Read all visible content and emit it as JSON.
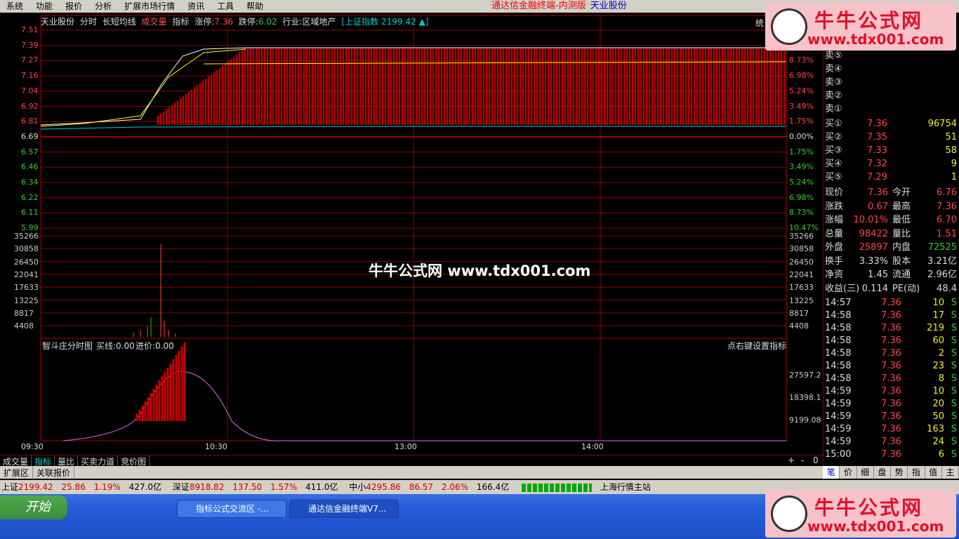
{
  "menu": [
    "系统",
    "功能",
    "报价",
    "分析",
    "扩展市场行情",
    "资讯",
    "工具",
    "帮助"
  ],
  "app_title": "通达信金融终端-内测版",
  "stock_name": "天业股份",
  "header": {
    "stock": "天业股份",
    "items": [
      "分时",
      "长短均线",
      "成交量",
      "指标"
    ],
    "limit_up_label": "涨停:",
    "limit_up": "7.36",
    "limit_down_label": "跌停:",
    "limit_down": "6.02",
    "industry": "行业:区域地产",
    "index_label": "[上证指数",
    "index_value": "2199.42",
    "index_arrow": "▲]",
    "top_right": "统"
  },
  "price_axis": [
    "7.51",
    "7.39",
    "7.27",
    "7.16",
    "7.04",
    "6.92",
    "6.81",
    "6.69",
    "6.57",
    "6.46",
    "6.34",
    "6.22",
    "6.11",
    "5.99"
  ],
  "pct_axis": [
    "8.73%",
    "6.98%",
    "5.24%",
    "3.49%",
    "1.75%",
    "0.00%",
    "1.75%",
    "3.49%",
    "5.24%",
    "6.98%",
    "8.73%",
    "10.47%"
  ],
  "volume_axis": [
    "35266",
    "30858",
    "26450",
    "22041",
    "17633",
    "13225",
    "8817",
    "4408"
  ],
  "indicator": {
    "title": "智斗庄分时图",
    "buy": "买线:0.00",
    "enter": "进价:0.00",
    "right_hint": "点右键设置指标",
    "axis": [
      "27597.2",
      "18398.1",
      "9199.08"
    ]
  },
  "time_axis": [
    "09:30",
    "10:30",
    "13:00",
    "14:00"
  ],
  "sell_levels": [
    "卖⑤",
    "卖④",
    "卖③",
    "卖②",
    "卖①"
  ],
  "buy_levels": [
    {
      "label": "买①",
      "price": "7.36",
      "vol": "96754"
    },
    {
      "label": "买②",
      "price": "7.35",
      "vol": "51"
    },
    {
      "label": "买③",
      "price": "7.33",
      "vol": "58"
    },
    {
      "label": "买④",
      "price": "7.32",
      "vol": "9"
    },
    {
      "label": "买⑤",
      "price": "7.29",
      "vol": "1"
    }
  ],
  "quote": [
    {
      "l1": "现价",
      "v1": "7.36",
      "l2": "今开",
      "v2": "6.76"
    },
    {
      "l1": "涨跌",
      "v1": "0.67",
      "l2": "最高",
      "v2": "7.36"
    },
    {
      "l1": "涨幅",
      "v1": "10.01%",
      "l2": "最低",
      "v2": "6.70"
    },
    {
      "l1": "总量",
      "v1": "98422",
      "l2": "量比",
      "v2": "1.51"
    },
    {
      "l1": "外盘",
      "v1": "25897",
      "l2": "内盘",
      "v2": "72525"
    },
    {
      "l1": "换手",
      "v1": "3.33%",
      "l2": "股本",
      "v2": "3.21亿"
    },
    {
      "l1": "净资",
      "v1": "1.45",
      "l2": "流通",
      "v2": "2.96亿"
    },
    {
      "l1": "收益(三)",
      "v1": "0.114",
      "l2": "PE(动)",
      "v2": "48.4"
    }
  ],
  "ticks": [
    {
      "t": "14:57",
      "p": "7.36",
      "v": "10",
      "s": "S"
    },
    {
      "t": "14:58",
      "p": "7.36",
      "v": "17",
      "s": "S"
    },
    {
      "t": "14:58",
      "p": "7.36",
      "v": "219",
      "s": "S"
    },
    {
      "t": "14:58",
      "p": "7.36",
      "v": "60",
      "s": "S"
    },
    {
      "t": "14:58",
      "p": "7.36",
      "v": "2",
      "s": "S"
    },
    {
      "t": "14:58",
      "p": "7.36",
      "v": "23",
      "s": "S"
    },
    {
      "t": "14:58",
      "p": "7.36",
      "v": "8",
      "s": "S"
    },
    {
      "t": "14:59",
      "p": "7.36",
      "v": "10",
      "s": "S"
    },
    {
      "t": "14:59",
      "p": "7.36",
      "v": "20",
      "s": "S"
    },
    {
      "t": "14:59",
      "p": "7.36",
      "v": "50",
      "s": "S"
    },
    {
      "t": "14:59",
      "p": "7.36",
      "v": "163",
      "s": "S"
    },
    {
      "t": "14:59",
      "p": "7.36",
      "v": "24",
      "s": "S"
    },
    {
      "t": "15:00",
      "p": "7.36",
      "v": "6",
      "s": "S"
    }
  ],
  "bottom_tabs": [
    "成交量",
    "指标",
    "量比",
    "买卖力道",
    "竞价图"
  ],
  "bottom_tabs2": [
    "扩展区",
    "关联报价"
  ],
  "side_tabs": [
    "笔",
    "价",
    "细",
    "盘",
    "势",
    "指",
    "值",
    "主"
  ],
  "status": {
    "sh_label": "上证",
    "sh": "2199.42",
    "sh_chg": "25.86",
    "sh_pct": "1.19%",
    "sh_amt": "427.0亿",
    "sz_label": "深证",
    "sz": "8918.82",
    "sz_chg": "137.50",
    "sz_pct": "1.57%",
    "sz_amt": "411.0亿",
    "zx_label": "中小",
    "zx": "4295.86",
    "zx_chg": "86.57",
    "zx_pct": "2.06%",
    "zx_amt": "166.4亿",
    "station": "上海行情主站"
  },
  "taskbar": {
    "start": "开始",
    "task1": "指标公式交流区 -...",
    "task2": "通达信金融终端V7..."
  },
  "watermark": {
    "name": "牛牛公式网",
    "url": "www.tdx001.com",
    "center": "牛牛公式网 www.tdx001.com"
  }
}
